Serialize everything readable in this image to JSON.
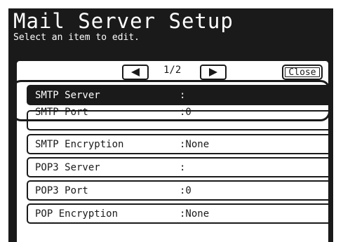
{
  "header": {
    "title": "Mail Server Setup",
    "subtitle": "Select an item to edit."
  },
  "nav": {
    "page_indicator": "1/2",
    "close_label": "Close"
  },
  "rows": [
    {
      "label": "SMTP Server",
      "value": ":"
    },
    {
      "label": "SMTP Port",
      "value": ":0"
    },
    {
      "label": "SMTP Encryption",
      "value": ":None"
    },
    {
      "label": "POP3 Server",
      "value": ":"
    },
    {
      "label": "POP3 Port",
      "value": ":0"
    },
    {
      "label": "POP Encryption",
      "value": ":None"
    }
  ],
  "selected_row_index": 0,
  "colors": {
    "screen_background": "#1a1a1a",
    "panel_background": "#ffffff",
    "selected_background": "#1a1a1a"
  }
}
